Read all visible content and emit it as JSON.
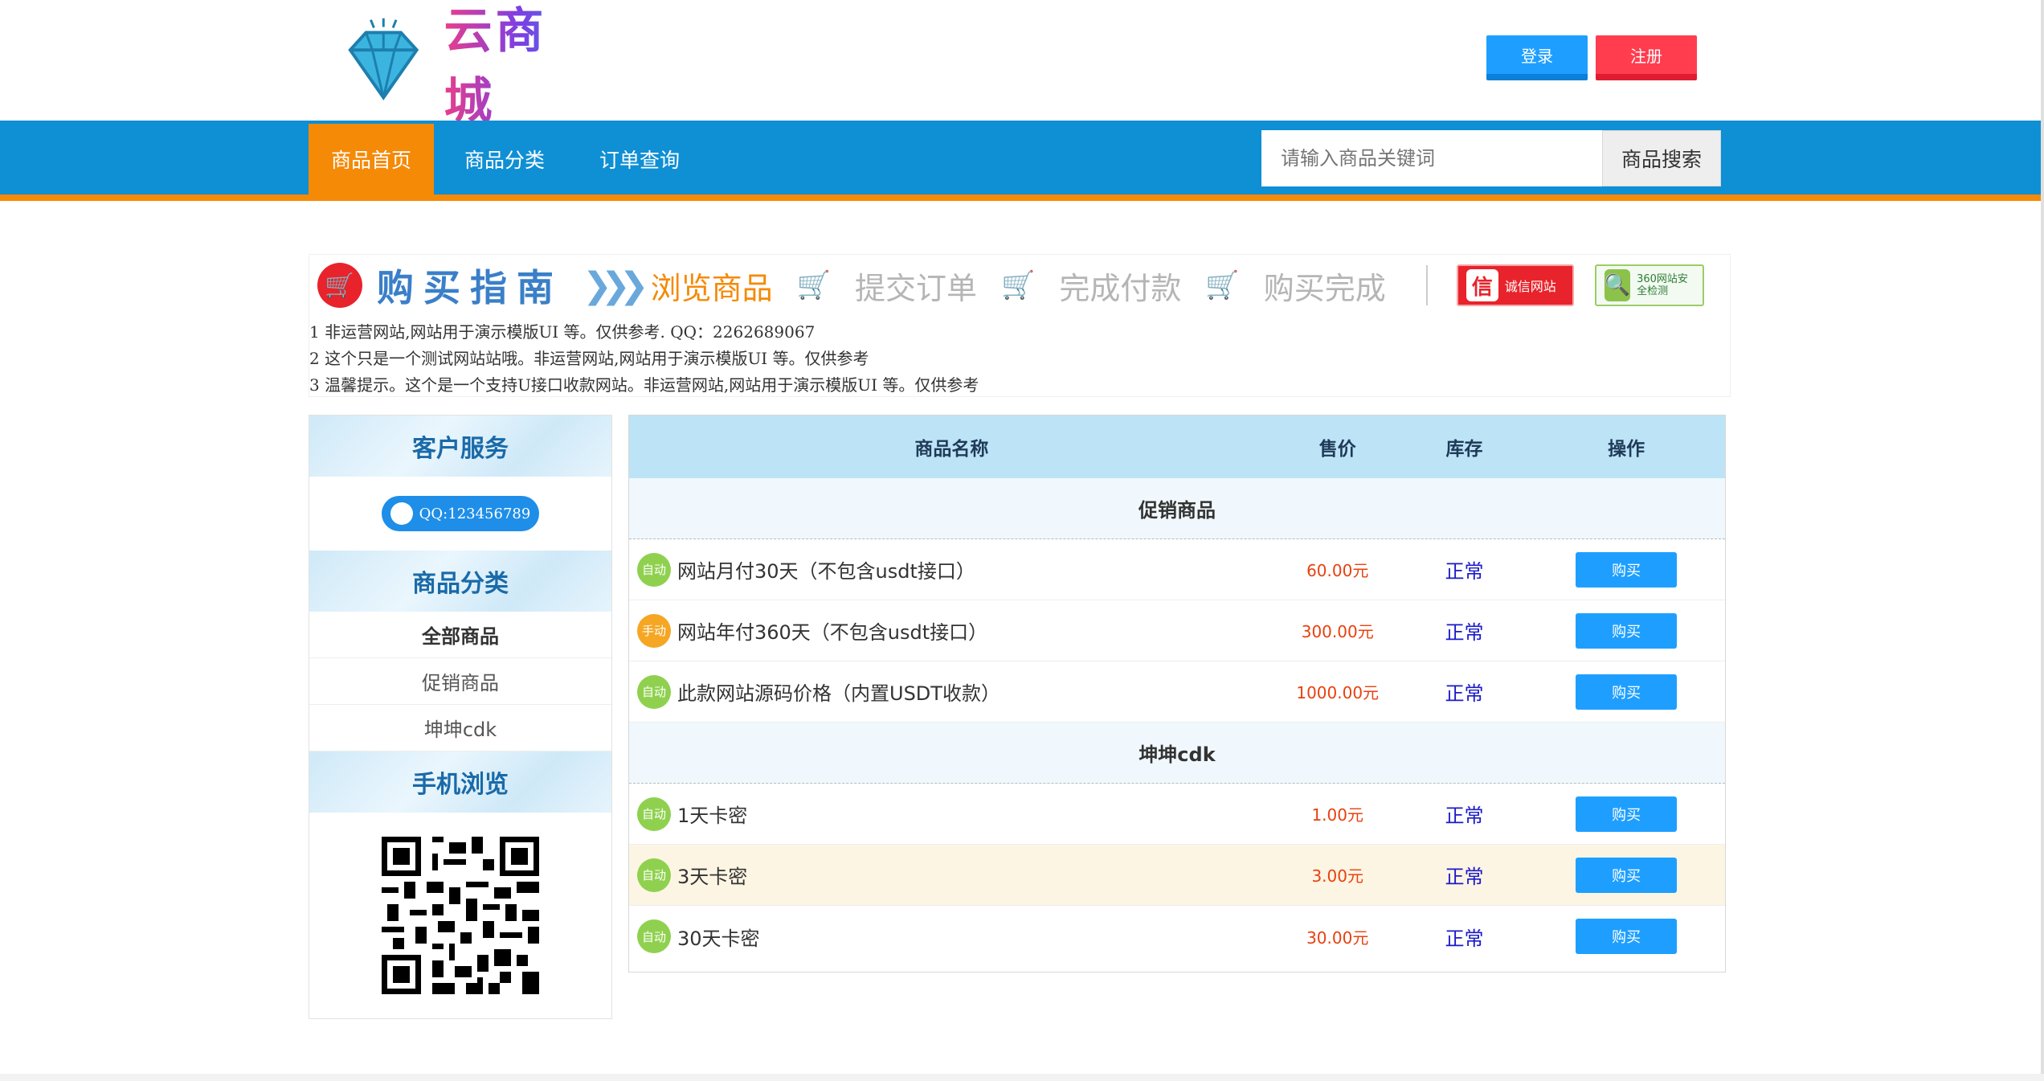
{
  "brand": {
    "name": "云商城"
  },
  "auth": {
    "login": "登录",
    "register": "注册"
  },
  "nav": {
    "items": [
      "商品首页",
      "商品分类",
      "订单查询"
    ],
    "search_placeholder": "请输入商品关键词",
    "search_button": "商品搜索"
  },
  "guide": {
    "title": "购买指南",
    "steps": [
      "浏览商品",
      "提交订单",
      "完成付款",
      "购买完成"
    ],
    "badges": [
      "诚信网站",
      "360网站安全检测"
    ],
    "notices": [
      "1 非运营网站,网站用于演示模版UI 等。仅供参考. QQ：2262689067",
      "2 这个只是一个测试网站站哦。非运营网站,网站用于演示模版UI 等。仅供参考",
      "3 温馨提示。这个是一个支持U接口收款网站。非运营网站,网站用于演示模版UI 等。仅供参考"
    ]
  },
  "sidebar": {
    "service_title": "客户服务",
    "qq": "QQ:123456789",
    "category_title": "商品分类",
    "categories": [
      "全部商品",
      "促销商品",
      "坤坤cdk"
    ],
    "mobile_title": "手机浏览"
  },
  "table": {
    "headers": [
      "商品名称",
      "售价",
      "库存",
      "操作"
    ],
    "buy_label": "购买",
    "groups": [
      {
        "name": "促销商品",
        "rows": [
          {
            "tag": "自动",
            "name": "网站月付30天（不包含usdt接口）",
            "price": "60.00元",
            "stock": "正常"
          },
          {
            "tag": "手动",
            "name": "网站年付360天（不包含usdt接口）",
            "price": "300.00元",
            "stock": "正常"
          },
          {
            "tag": "自动",
            "name": "此款网站源码价格（内置USDT收款）",
            "price": "1000.00元",
            "stock": "正常"
          }
        ]
      },
      {
        "name": "坤坤cdk",
        "rows": [
          {
            "tag": "自动",
            "name": "1天卡密",
            "price": "1.00元",
            "stock": "正常"
          },
          {
            "tag": "自动",
            "name": "3天卡密",
            "price": "3.00元",
            "stock": "正常"
          },
          {
            "tag": "自动",
            "name": "30天卡密",
            "price": "30.00元",
            "stock": "正常"
          }
        ]
      }
    ]
  },
  "colors": {
    "primary": "#0f8fd4",
    "accent": "#f58a07",
    "button": "#1e9fff",
    "register": "#ff3d4f",
    "price": "#e8410f"
  }
}
